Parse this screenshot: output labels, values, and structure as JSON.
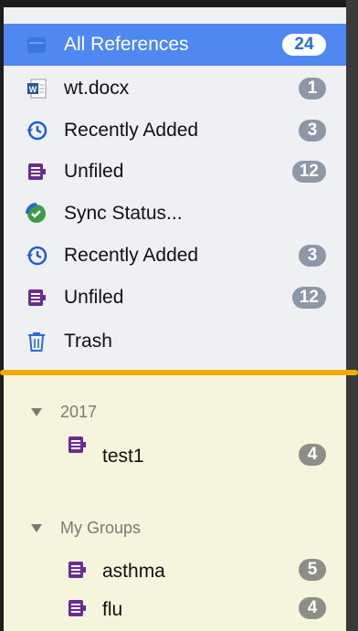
{
  "sidebar": {
    "items": [
      {
        "label": "All References",
        "count": "24",
        "icon": "library-icon"
      },
      {
        "label": "wt.docx",
        "count": "1",
        "icon": "word-doc-icon"
      },
      {
        "label": "Recently Added",
        "count": "3",
        "icon": "clock-icon"
      },
      {
        "label": "Unfiled",
        "count": "12",
        "icon": "unfiled-icon"
      },
      {
        "label": "Sync Status...",
        "count": "",
        "icon": "sync-check-icon"
      },
      {
        "label": "Recently Added",
        "count": "3",
        "icon": "clock-icon"
      },
      {
        "label": "Unfiled",
        "count": "12",
        "icon": "unfiled-icon"
      },
      {
        "label": "Trash",
        "count": "",
        "icon": "trash-icon"
      }
    ]
  },
  "groups": [
    {
      "header": "2017",
      "items": [
        {
          "label": "test1",
          "count": "4"
        }
      ]
    },
    {
      "header": "My Groups",
      "items": [
        {
          "label": "asthma",
          "count": "5"
        },
        {
          "label": "flu",
          "count": "4"
        }
      ]
    }
  ],
  "colors": {
    "selection": "#4f88f0",
    "divider": "#f0ad00",
    "group_bg": "#f5f4dc",
    "badge": "#8e97a6"
  }
}
